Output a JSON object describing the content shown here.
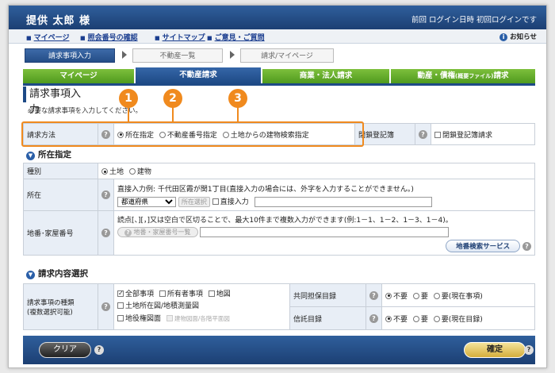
{
  "header": {
    "user_name": "提供 太郎 様",
    "last_login": "前回 ログイン日時 初回ログインです"
  },
  "nav": {
    "links": [
      "マイページ",
      "照会番号の確認",
      "サイトマップ",
      "ご意見・ご質問"
    ],
    "notice": "お知らせ"
  },
  "steps": [
    "請求事項入力",
    "不動産一覧",
    "請求/マイページ"
  ],
  "tabs": {
    "mypage": "マイページ",
    "real_estate": "不動産請求",
    "commercial": "商業・法人請求",
    "movable_main": "動産・債権",
    "movable_small": "(概要ファイル)",
    "movable_tail": "請求"
  },
  "page_title": "請求事項入力",
  "instruction": "必要な請求事項を入力してください。",
  "callouts": [
    "1",
    "2",
    "3"
  ],
  "request_method": {
    "label": "請求方法",
    "options": [
      "所在指定",
      "不動産番号指定",
      "土地からの建物検索指定"
    ],
    "selected": 0,
    "closed_registry_label": "閉鎖登記簿",
    "closed_registry_checkbox": "閉鎖登記簿請求"
  },
  "location_section": {
    "heading": "所在指定",
    "type_label": "種別",
    "type_options": [
      "土地",
      "建物"
    ],
    "type_selected": 0,
    "location_label": "所在",
    "direct_input_example": "直接入力例: 千代田区霞が関1丁目(直接入力の場合には、外字を入力することができません。)",
    "prefecture_select": "都道府県",
    "location_select_btn": "所在選択",
    "direct_input_checkbox": "直接入力",
    "lot_label": "地番･家屋番号",
    "lot_help_text": "読点[、][，]又は空白で区切ることで、最大10件まで複数入力ができます(例:1－1、1－2、1－3、1－4)。",
    "lot_list_btn": "地番・家屋番号一覧",
    "lot_search_btn": "地番検索サービス"
  },
  "request_section": {
    "heading": "請求内容選択",
    "kind_label_1": "請求事項の種類",
    "kind_label_2": "(複数選択可能)",
    "kind_options": [
      {
        "label": "全部事項",
        "checked": true
      },
      {
        "label": "所有者事項",
        "checked": false
      },
      {
        "label": "地図",
        "checked": false
      },
      {
        "label": "土地所在図/地積測量図",
        "checked": false
      },
      {
        "label": "地役権図面",
        "checked": false
      },
      {
        "label": "建物図面/各階平面図",
        "checked": false,
        "disabled": true
      }
    ],
    "joint_label": "共同担保目録",
    "joint_options": [
      "不要",
      "要",
      "要(現在事項)"
    ],
    "joint_selected": 0,
    "trust_label": "信託目録",
    "trust_options": [
      "不要",
      "要",
      "要(現在目録)"
    ],
    "trust_selected": 0
  },
  "footer": {
    "clear": "クリア",
    "confirm": "確定",
    "help": "?"
  }
}
